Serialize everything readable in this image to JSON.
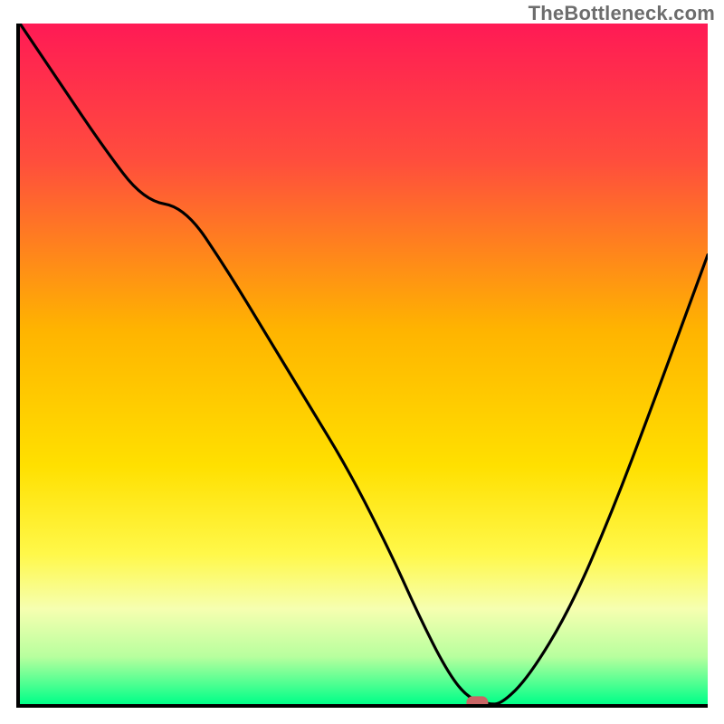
{
  "watermark": "TheBottleneck.com",
  "chart_data": {
    "type": "line",
    "title": "",
    "xlabel": "",
    "ylabel": "",
    "xlim": [
      0,
      100
    ],
    "ylim": [
      0,
      100
    ],
    "grid": false,
    "legend": false,
    "gradient_stops": [
      {
        "offset": 0,
        "color": "#ff1a55"
      },
      {
        "offset": 20,
        "color": "#ff4d3d"
      },
      {
        "offset": 45,
        "color": "#ffb400"
      },
      {
        "offset": 65,
        "color": "#ffe000"
      },
      {
        "offset": 78,
        "color": "#fff84a"
      },
      {
        "offset": 86,
        "color": "#f6ffb0"
      },
      {
        "offset": 93,
        "color": "#b8ff9e"
      },
      {
        "offset": 100,
        "color": "#00ff88"
      }
    ],
    "series": [
      {
        "name": "bottleneck-curve",
        "x": [
          0,
          6,
          12,
          18,
          24,
          30,
          36,
          42,
          48,
          54,
          58,
          62,
          65,
          68,
          70,
          74,
          80,
          86,
          92,
          100
        ],
        "y": [
          100,
          91,
          82,
          74,
          73,
          64,
          54,
          44,
          34,
          22,
          13,
          5,
          1,
          0,
          0,
          4,
          14,
          28,
          44,
          66
        ]
      }
    ],
    "marker": {
      "x_range": [
        65,
        68
      ],
      "y": 0,
      "color": "#c96565"
    }
  }
}
